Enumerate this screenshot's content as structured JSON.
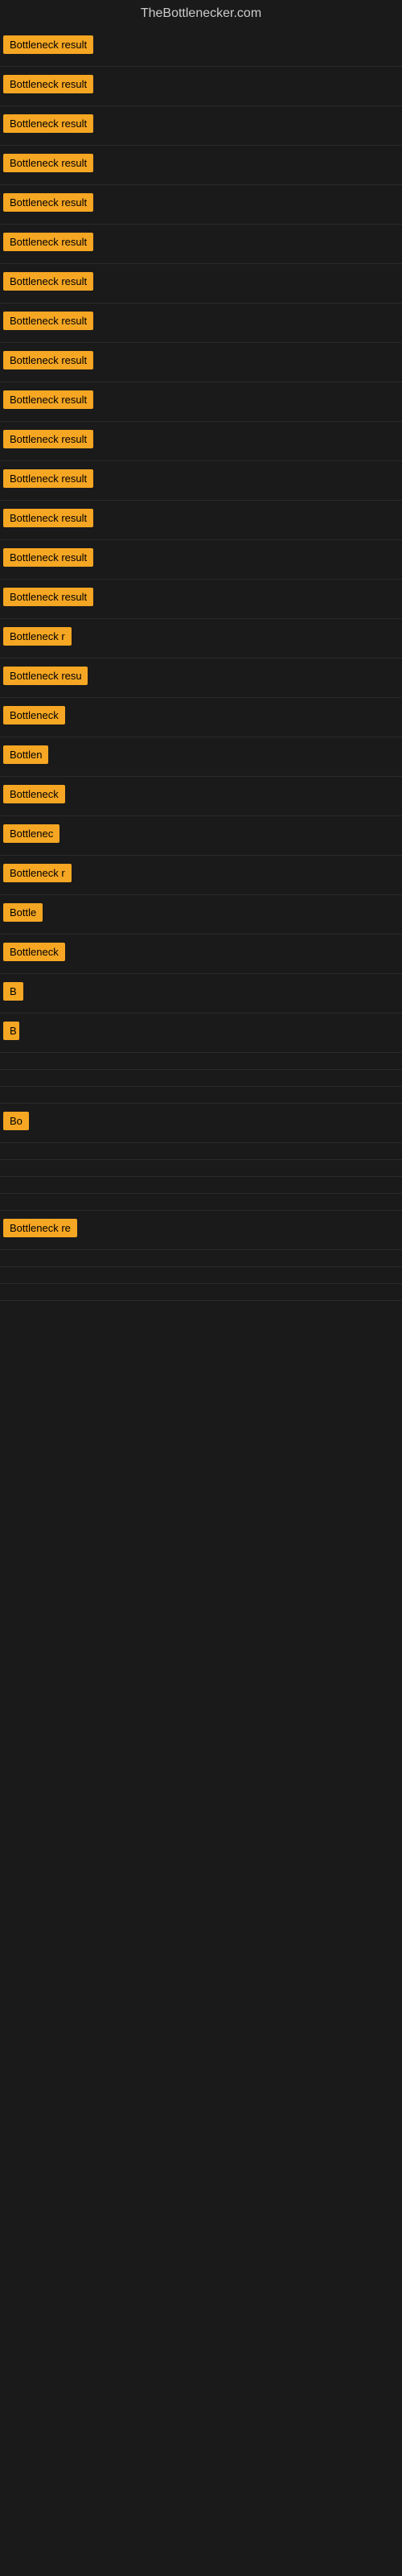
{
  "site": {
    "title": "TheBottlenecker.com"
  },
  "rows": [
    {
      "id": 1,
      "label": "Bottleneck result",
      "width": 140,
      "visible": true
    },
    {
      "id": 2,
      "label": "Bottleneck result",
      "width": 138,
      "visible": true
    },
    {
      "id": 3,
      "label": "Bottleneck result",
      "width": 136,
      "visible": true
    },
    {
      "id": 4,
      "label": "Bottleneck result",
      "width": 134,
      "visible": true
    },
    {
      "id": 5,
      "label": "Bottleneck result",
      "width": 132,
      "visible": true
    },
    {
      "id": 6,
      "label": "Bottleneck result",
      "width": 130,
      "visible": true
    },
    {
      "id": 7,
      "label": "Bottleneck result",
      "width": 128,
      "visible": true
    },
    {
      "id": 8,
      "label": "Bottleneck result",
      "width": 126,
      "visible": true
    },
    {
      "id": 9,
      "label": "Bottleneck result",
      "width": 124,
      "visible": true
    },
    {
      "id": 10,
      "label": "Bottleneck result",
      "width": 122,
      "visible": true
    },
    {
      "id": 11,
      "label": "Bottleneck result",
      "width": 120,
      "visible": true
    },
    {
      "id": 12,
      "label": "Bottleneck result",
      "width": 118,
      "visible": true
    },
    {
      "id": 13,
      "label": "Bottleneck result",
      "width": 116,
      "visible": true
    },
    {
      "id": 14,
      "label": "Bottleneck result",
      "width": 114,
      "visible": true
    },
    {
      "id": 15,
      "label": "Bottleneck result",
      "width": 112,
      "visible": true
    },
    {
      "id": 16,
      "label": "Bottleneck r",
      "width": 100,
      "visible": true
    },
    {
      "id": 17,
      "label": "Bottleneck resu",
      "width": 105,
      "visible": true
    },
    {
      "id": 18,
      "label": "Bottleneck",
      "width": 88,
      "visible": true
    },
    {
      "id": 19,
      "label": "Bottlen",
      "width": 72,
      "visible": true
    },
    {
      "id": 20,
      "label": "Bottleneck",
      "width": 86,
      "visible": true
    },
    {
      "id": 21,
      "label": "Bottlenec",
      "width": 80,
      "visible": true
    },
    {
      "id": 22,
      "label": "Bottleneck r",
      "width": 96,
      "visible": true
    },
    {
      "id": 23,
      "label": "Bottle",
      "width": 65,
      "visible": true
    },
    {
      "id": 24,
      "label": "Bottleneck",
      "width": 84,
      "visible": true
    },
    {
      "id": 25,
      "label": "B",
      "width": 28,
      "visible": true
    },
    {
      "id": 26,
      "label": "B",
      "width": 20,
      "visible": true
    },
    {
      "id": 27,
      "label": "",
      "width": 0,
      "visible": false
    },
    {
      "id": 28,
      "label": "",
      "width": 0,
      "visible": false
    },
    {
      "id": 29,
      "label": "",
      "width": 0,
      "visible": false
    },
    {
      "id": 30,
      "label": "Bo",
      "width": 32,
      "visible": true
    },
    {
      "id": 31,
      "label": "",
      "width": 0,
      "visible": false
    },
    {
      "id": 32,
      "label": "",
      "width": 0,
      "visible": false
    },
    {
      "id": 33,
      "label": "",
      "width": 0,
      "visible": false
    },
    {
      "id": 34,
      "label": "",
      "width": 0,
      "visible": false
    },
    {
      "id": 35,
      "label": "Bottleneck re",
      "width": 108,
      "visible": true
    },
    {
      "id": 36,
      "label": "",
      "width": 0,
      "visible": false
    },
    {
      "id": 37,
      "label": "",
      "width": 0,
      "visible": false
    },
    {
      "id": 38,
      "label": "",
      "width": 0,
      "visible": false
    }
  ]
}
